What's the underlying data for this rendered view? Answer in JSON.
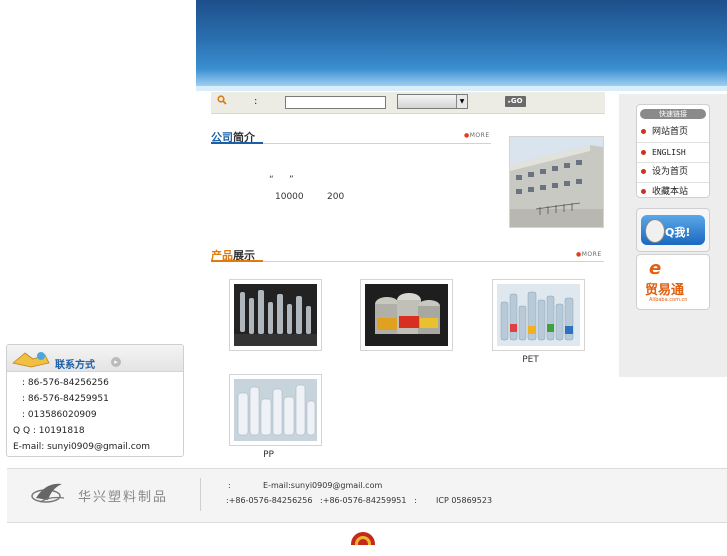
{
  "search": {
    "colon": ":",
    "go_label": "GO"
  },
  "about": {
    "title_a": "公司",
    "title_b": "简介",
    "more": "MORE",
    "quote_left": "“",
    "quote_right": "”",
    "num_a": "10000",
    "num_b": "200"
  },
  "products": {
    "title_a": "产品",
    "title_b": "展示",
    "more": "MORE",
    "items": [
      {
        "caption": ""
      },
      {
        "caption": ""
      },
      {
        "caption": "PET"
      },
      {
        "caption": "PP"
      }
    ]
  },
  "quicklinks": {
    "title": "快速链接",
    "items": [
      {
        "label": "网站首页"
      },
      {
        "label": "ENGLISH"
      },
      {
        "label": "设为首页"
      },
      {
        "label": "收藏本站"
      }
    ]
  },
  "qq_badge": {
    "label": "Q我!"
  },
  "alibaba_badge": {
    "label": "贸易通",
    "sub": "Alibaba.com.cn"
  },
  "contact": {
    "title": "联系方式",
    "lines": [
      ": 86-576-84256256",
      ": 86-576-84259951",
      ": 013586020909",
      "Q Q : 10191818",
      "E-mail: sunyi0909@gmail.com"
    ]
  },
  "footer": {
    "logo_text": "华兴塑料制品",
    "line1_colon": ":",
    "line1_email": "E-mail:sunyi0909@gmail.com",
    "line2": ":+86-0576-84256256   :+86-0576-84259951   :",
    "icp": "ICP 05869523"
  },
  "colors": {
    "accent": "#1a5fa8",
    "banner": "#2a6fb0",
    "orange": "#e07a10"
  }
}
